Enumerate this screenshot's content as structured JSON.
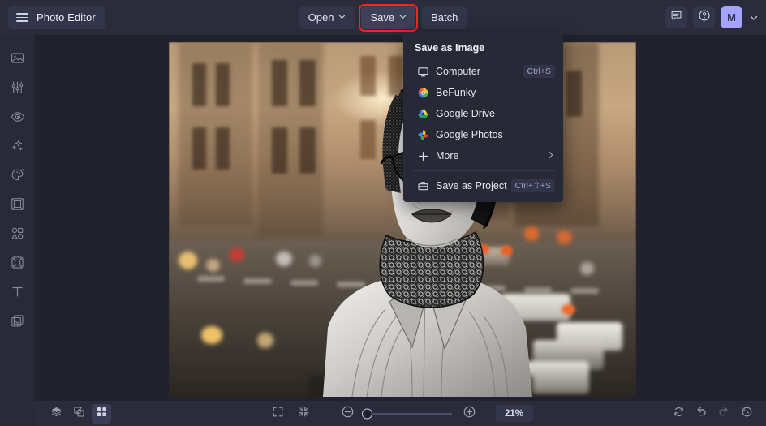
{
  "app": {
    "brand_title": "Photo Editor",
    "accent_highlight": "#ff2020",
    "avatar_color": "#a5a3fb",
    "header_bg": "#2a2c3b",
    "canvas_bg": "#21222e",
    "menu_bg": "#272937"
  },
  "header": {
    "menu_icon": "hamburger-icon",
    "tools": [
      {
        "label": "Open",
        "has_chevron": true,
        "name": "open-button"
      },
      {
        "label": "Save",
        "has_chevron": true,
        "name": "save-button"
      },
      {
        "label": "Batch",
        "has_chevron": false,
        "name": "batch-button"
      }
    ],
    "right_icons": [
      {
        "name": "feedback-icon",
        "title": "Feedback"
      },
      {
        "name": "help-icon",
        "title": "Help"
      }
    ],
    "avatar": {
      "initial": "M",
      "name": "avatar"
    }
  },
  "sidebar": {
    "items": [
      {
        "name": "sidebar-item-image",
        "icon": "image-icon"
      },
      {
        "name": "sidebar-item-edit",
        "icon": "sliders-icon"
      },
      {
        "name": "sidebar-item-retouch",
        "icon": "eye-icon"
      },
      {
        "name": "sidebar-item-effects",
        "icon": "sparkles-icon"
      },
      {
        "name": "sidebar-item-artsy",
        "icon": "palette-icon"
      },
      {
        "name": "sidebar-item-frames",
        "icon": "frame-icon"
      },
      {
        "name": "sidebar-item-graphics",
        "icon": "shapes-icon"
      },
      {
        "name": "sidebar-item-overlays",
        "icon": "overlay-frame-icon"
      },
      {
        "name": "sidebar-item-text",
        "icon": "text-icon"
      },
      {
        "name": "sidebar-item-textures",
        "icon": "textures-icon"
      }
    ]
  },
  "menu": {
    "title": "Save as Image",
    "items": [
      {
        "label": "Computer",
        "icon": "computer-icon",
        "shortcut": "Ctrl+S",
        "name": "menu-item-computer",
        "chevron": false
      },
      {
        "label": "BeFunky",
        "icon": "befunky-icon",
        "shortcut": "",
        "name": "menu-item-befunky",
        "chevron": false
      },
      {
        "label": "Google Drive",
        "icon": "google-drive-icon",
        "shortcut": "",
        "name": "menu-item-google-drive",
        "chevron": false
      },
      {
        "label": "Google Photos",
        "icon": "google-photos-icon",
        "shortcut": "",
        "name": "menu-item-google-photos",
        "chevron": false
      },
      {
        "label": "More",
        "icon": "plus-icon",
        "shortcut": "",
        "name": "menu-item-more",
        "chevron": true
      }
    ],
    "project": {
      "label": "Save as Project",
      "icon": "briefcase-icon",
      "shortcut": "Ctrl+⇧+S",
      "name": "menu-item-save-as-project"
    }
  },
  "bottombar": {
    "left_tools": [
      {
        "name": "layers-button",
        "icon": "layers-icon",
        "active": false
      },
      {
        "name": "compare-button",
        "icon": "compare-icon",
        "active": false
      },
      {
        "name": "grid-button",
        "icon": "grid-icon",
        "active": true
      }
    ],
    "view_tools": [
      {
        "name": "fit-screen-button",
        "icon": "expand-icon"
      },
      {
        "name": "actual-size-button",
        "icon": "collapse-icon"
      }
    ],
    "zoom": {
      "out_name": "zoom-out-button",
      "in_name": "zoom-in-button",
      "level": "21%",
      "slider_name": "zoom-slider",
      "slider_position_pct": 0
    },
    "right_tools": [
      {
        "name": "reset-button",
        "icon": "reset-icon",
        "dim": false
      },
      {
        "name": "undo-button",
        "icon": "undo-icon",
        "dim": false
      },
      {
        "name": "redo-button",
        "icon": "redo-icon",
        "dim": true
      },
      {
        "name": "history-button",
        "icon": "history-icon",
        "dim": false
      }
    ]
  },
  "canvas": {
    "photo_alt": "woman-with-sunglasses-street-scene",
    "zoom_label": "21%"
  }
}
